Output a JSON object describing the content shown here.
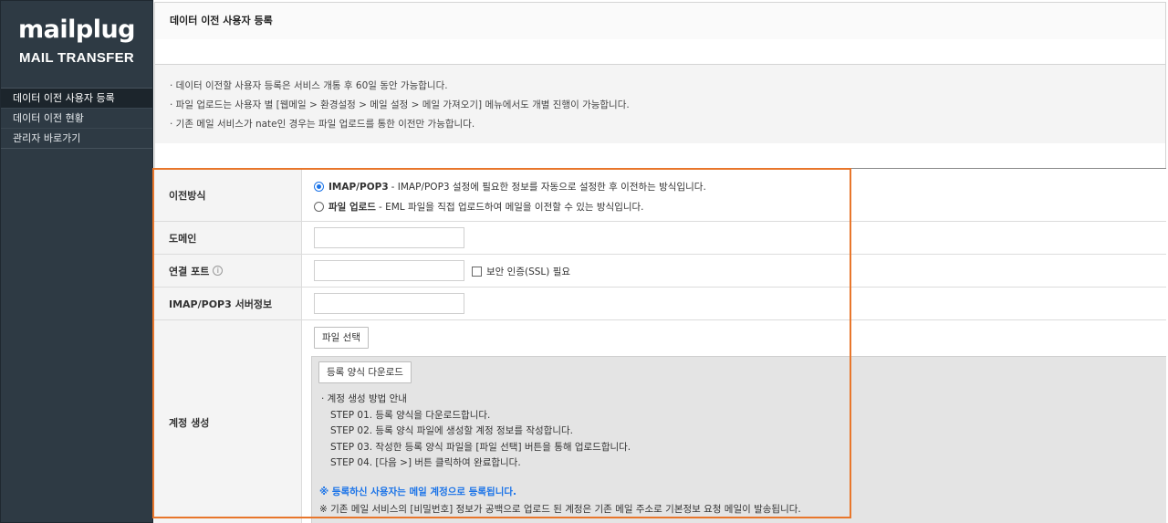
{
  "sidebar": {
    "logo": "mailplug",
    "logo_sub": "MAIL TRANSFER",
    "items": [
      {
        "label": "데이터 이전 사용자 등록"
      },
      {
        "label": "데이터 이전 현황"
      },
      {
        "label": "관리자 바로가기"
      }
    ]
  },
  "header": {
    "title": "데이터 이전 사용자 등록"
  },
  "notice": {
    "lines": [
      "· 데이터 이전할 사용자 등록은 서비스 개통 후 60일 동안 가능합니다.",
      "· 파일 업로드는 사용자 별 [웹메일 > 환경설정 > 메일 설정 > 메일 가져오기] 메뉴에서도 개별 진행이 가능합니다.",
      "· 기존 메일 서비스가 nate인 경우는 파일 업로드를 통한 이전만 가능합니다."
    ]
  },
  "form": {
    "method": {
      "label": "이전방식",
      "option1_strong": "IMAP/POP3",
      "option1_desc": "- IMAP/POP3 설정에 필요한 정보를 자동으로 설정한 후 이전하는 방식입니다.",
      "option2_strong": "파일 업로드",
      "option2_desc": "- EML 파일을 직접 업로드하여 메일을 이전할 수 있는 방식입니다.",
      "selected": "IMAP/POP3"
    },
    "domain": {
      "label": "도메인",
      "value": ""
    },
    "port": {
      "label": "연결 포트",
      "info": "i",
      "value": "",
      "ssl_label": "보안 인증(SSL) 필요",
      "ssl_checked": false
    },
    "server": {
      "label": "IMAP/POP3 서버정보",
      "value": ""
    },
    "account": {
      "label": "계정 생성",
      "file_button": "파일 선택",
      "download_button": "등록 양식 다운로드",
      "guide_title": "· 계정 생성 방법 안내",
      "steps": [
        "STEP 01. 등록 양식을 다운로드합니다.",
        "STEP 02. 등록 양식 파일에 생성할 계정 정보를 작성합니다.",
        "STEP 03. 작성한 등록 양식 파일을 [파일 선택] 버튼을 통해 업로드합니다.",
        "STEP 04. [다음 >] 버튼 클릭하여 완료합니다."
      ],
      "notice": "※ 등록하신 사용자는 메일 계정으로 등록됩니다.",
      "warning": "※ 기존 메일 서비스의 [비밀번호] 정보가 공백으로 업로드 된 계정은 기존 메일 주소로 기본정보 요청 메일이 발송됩니다."
    }
  },
  "colors": {
    "sidebar_bg": "#2e3a44",
    "accent": "#1a73e8",
    "highlight": "#e8762b"
  }
}
